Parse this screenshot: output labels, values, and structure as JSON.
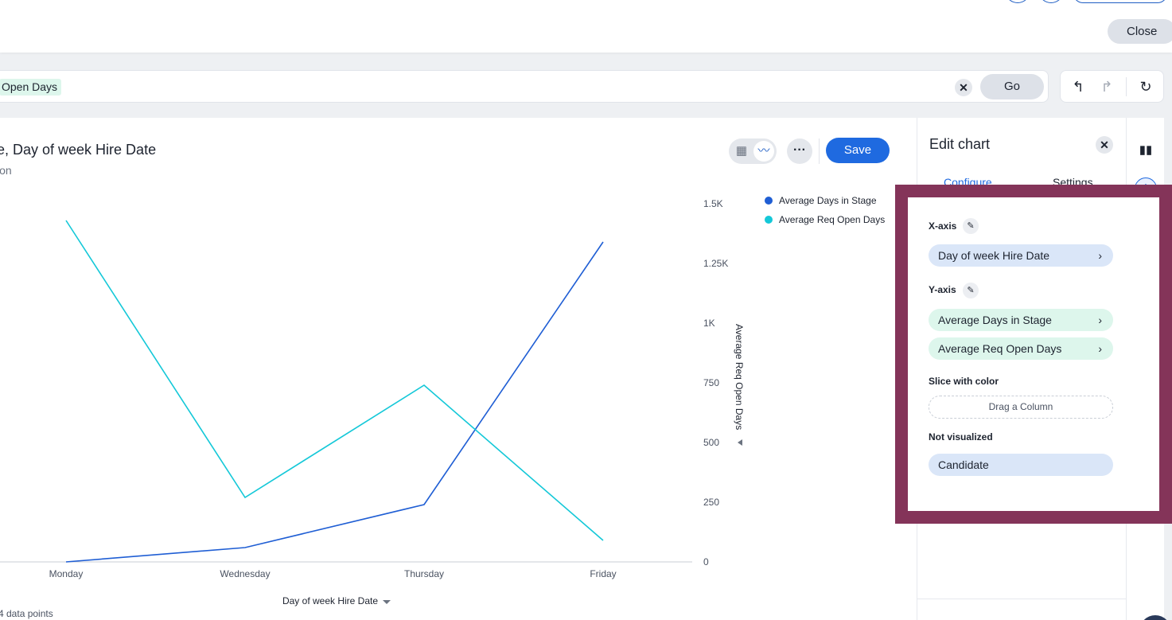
{
  "header": {
    "close_label": "Close"
  },
  "search": {
    "token": "Open Days",
    "clear_icon": "close-icon",
    "go_label": "Go"
  },
  "history": {
    "undo_icon": "undo-icon",
    "redo_icon": "redo-icon",
    "reset_icon": "reset-icon"
  },
  "chart_header": {
    "title": "e, Day of week Hire Date",
    "subtitle": "ion",
    "save_label": "Save",
    "more_label": "···",
    "data_points_label": "4 data points"
  },
  "chart_data": {
    "type": "line",
    "categories": [
      "Monday",
      "Wednesday",
      "Thursday",
      "Friday"
    ],
    "series": [
      {
        "name": "Average Days in Stage",
        "color": "#1f5ed4",
        "values": [
          null,
          60,
          240,
          1340
        ]
      },
      {
        "name": "Average Req Open Days",
        "color": "#14c8d8",
        "values": [
          1430,
          270,
          740,
          90
        ]
      }
    ],
    "y_right": {
      "label": "Average Req Open Days",
      "ticks": [
        "0",
        "250",
        "500",
        "750",
        "1K",
        "1.25K",
        "1.5K"
      ],
      "tick_values": [
        0,
        250,
        500,
        750,
        1000,
        1250,
        1500
      ],
      "ylim": [
        0,
        1500
      ]
    },
    "xlabel": "Day of week Hire Date",
    "legend_position": "top-right",
    "grid": false
  },
  "panel": {
    "title": "Edit chart",
    "tabs": [
      "Configure",
      "Settings"
    ],
    "x_axis_label": "X-axis",
    "x_axis_items": [
      "Day of week Hire Date"
    ],
    "y_axis_label": "Y-axis",
    "y_axis_items": [
      "Average Days in Stage",
      "Average Req Open Days"
    ],
    "slice_label": "Slice with color",
    "drop_zone_label": "Drag a Column",
    "not_visualized_label": "Not visualized",
    "not_visualized_items": [
      "Candidate"
    ]
  },
  "rail": {
    "icons": [
      "bar-chart-icon",
      "gear-icon"
    ]
  },
  "colors": {
    "accent": "#1f6ae0",
    "highlight_frame": "#843459",
    "series_1": "#1f5ed4",
    "series_2": "#14c8d8"
  }
}
